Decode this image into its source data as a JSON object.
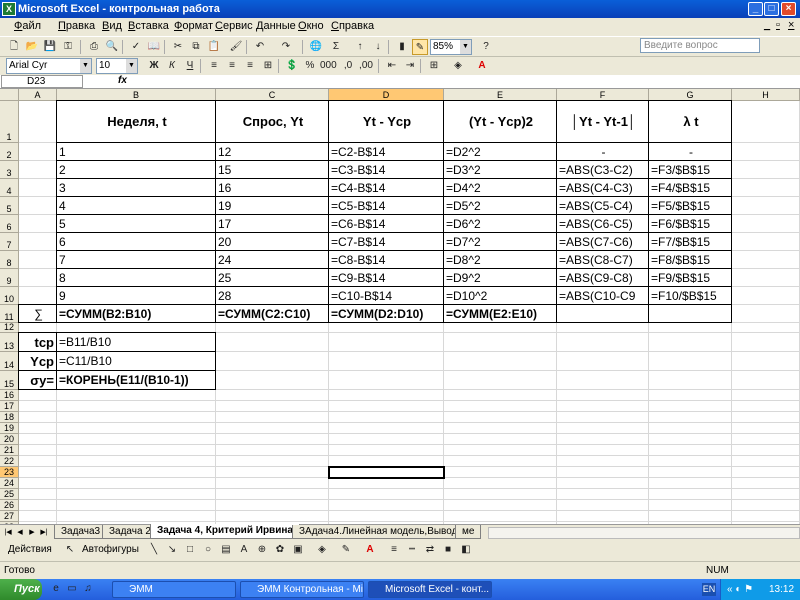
{
  "window": {
    "title": "Microsoft Excel - контрольная работа"
  },
  "menu": [
    "Файл",
    "Правка",
    "Вид",
    "Вставка",
    "Формат",
    "Сервис",
    "Данные",
    "Окно",
    "Справка"
  ],
  "help_placeholder": "Введите вопрос",
  "toolbar": {
    "zoom": "85%",
    "font": "Arial Cyr",
    "size": "10"
  },
  "namebox": "D23",
  "fx_label": "fx",
  "columns": [
    "A",
    "B",
    "C",
    "D",
    "E",
    "F",
    "G",
    "H"
  ],
  "selected_column": "D",
  "selected_row": "23",
  "headers": {
    "B": "Неделя, t",
    "C": "Спрос, Yt",
    "D": "Yt - Ycp",
    "E": "(Yt - Ycp)2",
    "F": "│Yt - Yt-1│",
    "G": "λ t"
  },
  "rows": [
    {
      "n": "2",
      "B": "1",
      "C": "12",
      "D": "=C2-B$14",
      "E": "=D2^2",
      "F": "-",
      "G": "-"
    },
    {
      "n": "3",
      "B": "2",
      "C": "15",
      "D": "=C3-B$14",
      "E": "=D3^2",
      "F": "=ABS(C3-C2)",
      "G": "=F3/$B$15"
    },
    {
      "n": "4",
      "B": "3",
      "C": "16",
      "D": "=C4-B$14",
      "E": "=D4^2",
      "F": "=ABS(C4-C3)",
      "G": "=F4/$B$15"
    },
    {
      "n": "5",
      "B": "4",
      "C": "19",
      "D": "=C5-B$14",
      "E": "=D5^2",
      "F": "=ABS(C5-C4)",
      "G": "=F5/$B$15"
    },
    {
      "n": "6",
      "B": "5",
      "C": "17",
      "D": "=C6-B$14",
      "E": "=D6^2",
      "F": "=ABS(C6-C5)",
      "G": "=F6/$B$15"
    },
    {
      "n": "7",
      "B": "6",
      "C": "20",
      "D": "=C7-B$14",
      "E": "=D7^2",
      "F": "=ABS(C7-C6)",
      "G": "=F7/$B$15"
    },
    {
      "n": "8",
      "B": "7",
      "C": "24",
      "D": "=C8-B$14",
      "E": "=D8^2",
      "F": "=ABS(C8-C7)",
      "G": "=F8/$B$15"
    },
    {
      "n": "9",
      "B": "8",
      "C": "25",
      "D": "=C9-B$14",
      "E": "=D9^2",
      "F": "=ABS(C9-C8)",
      "G": "=F9/$B$15"
    },
    {
      "n": "10",
      "B": "9",
      "C": "28",
      "D": "=C10-B$14",
      "E": "=D10^2",
      "F": "=ABS(C10-C9",
      "G": "=F10/$B$15"
    }
  ],
  "sum_row": {
    "A": "∑",
    "B": "=СУММ(B2:B10)",
    "C": "=СУММ(C2:C10)",
    "D": "=СУММ(D2:D10)",
    "E": "=СУММ(E2:E10)"
  },
  "stats": [
    {
      "n": "13",
      "label": "tср",
      "value": "=B11/B10"
    },
    {
      "n": "14",
      "label": "Yср",
      "value": "=C11/B10"
    },
    {
      "n": "15",
      "label": "σy=",
      "value": "=КОРЕНЬ(E11/(B10-1))"
    }
  ],
  "sheet_tabs": [
    "Задача3",
    "Задача 2",
    "Задача 4, Критерий Ирвина",
    "ЗАдача4.Линейная модель,Вывод",
    "ме"
  ],
  "active_tab": "Задача 4, Критерий Ирвина",
  "drawbar": {
    "actions": "Действия",
    "autoshapes": "Автофигуры"
  },
  "status": {
    "ready": "Готово",
    "num": "NUM"
  },
  "taskbar": {
    "start": "Пуск",
    "tasks": [
      "ЭММ",
      "ЭММ Контрольная - Mic...",
      "Microsoft Excel - конт..."
    ],
    "lang": "EN",
    "time": "13:12"
  }
}
